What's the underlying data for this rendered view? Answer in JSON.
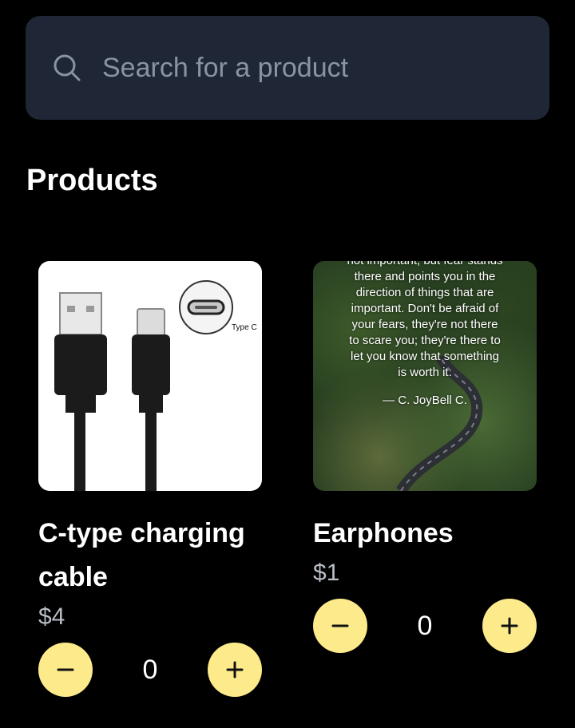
{
  "search": {
    "placeholder": "Search for a product",
    "icon": "search-icon"
  },
  "section": {
    "title": "Products"
  },
  "products": [
    {
      "name": "C-type charging cable",
      "price": "$4",
      "quantity": "0",
      "image": {
        "type_c_label": "Type C"
      }
    },
    {
      "name": "Earphones",
      "price": "$1",
      "quantity": "0",
      "image": {
        "quote": "not important, but fear stands\nthere and points you in the\ndirection of things that are\nimportant. Don't be afraid of\nyour fears, they're not there\nto scare you; they're there to\nlet you know that something\nis worth it.",
        "author": "— C. JoyBell C."
      }
    }
  ],
  "colors": {
    "background": "#000000",
    "search_bg": "#1f2736",
    "accent": "#fcea8b",
    "price": "#b9bec7"
  },
  "icons": {
    "decrement": "minus-icon",
    "increment": "plus-icon"
  }
}
